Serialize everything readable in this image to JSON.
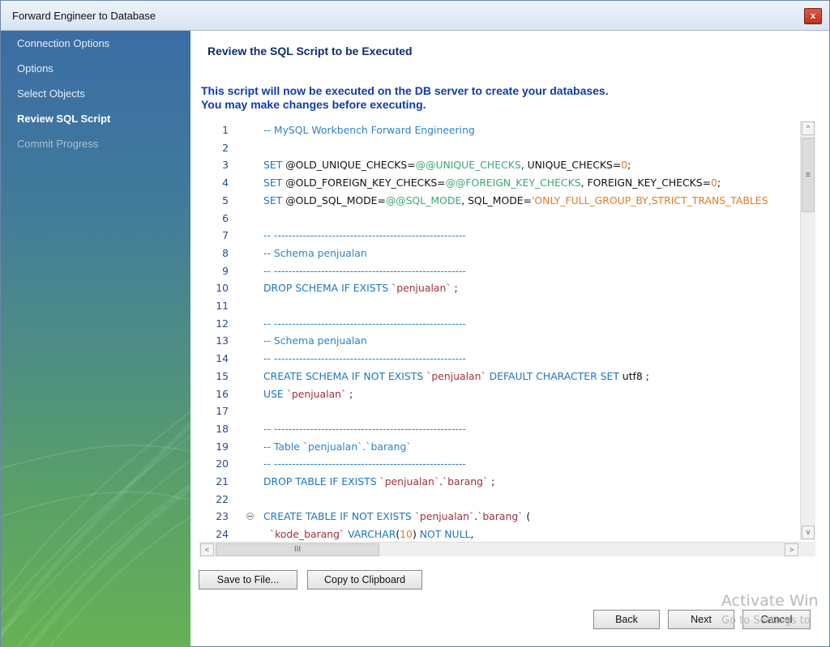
{
  "window": {
    "title": "Forward Engineer to Database",
    "close_glyph": "x"
  },
  "sidebar": {
    "items": [
      {
        "label": "Connection Options",
        "state": "normal"
      },
      {
        "label": "Options",
        "state": "normal"
      },
      {
        "label": "Select Objects",
        "state": "normal"
      },
      {
        "label": "Review SQL Script",
        "state": "active"
      },
      {
        "label": "Commit Progress",
        "state": "disabled"
      }
    ]
  },
  "main": {
    "heading": "Review the SQL Script to be Executed",
    "description_line1": "This script will now be executed on the DB server to create your databases.",
    "description_line2": "You may make changes before executing."
  },
  "editor": {
    "lines": [
      {
        "n": "1",
        "t": [
          [
            "cm",
            "-- MySQL Workbench Forward Engineering"
          ]
        ]
      },
      {
        "n": "2",
        "t": []
      },
      {
        "n": "3",
        "t": [
          [
            "kw",
            "SET "
          ],
          [
            "",
            "@OLD_UNIQUE_CHECKS="
          ],
          [
            "sv",
            "@@UNIQUE_CHECKS"
          ],
          [
            "",
            ", UNIQUE_CHECKS="
          ],
          [
            "num",
            "0"
          ],
          [
            "",
            ";"
          ]
        ]
      },
      {
        "n": "4",
        "t": [
          [
            "kw",
            "SET "
          ],
          [
            "",
            "@OLD_FOREIGN_KEY_CHECKS="
          ],
          [
            "sv",
            "@@FOREIGN_KEY_CHECKS"
          ],
          [
            "",
            ", FOREIGN_KEY_CHECKS="
          ],
          [
            "num",
            "0"
          ],
          [
            "",
            ";"
          ]
        ]
      },
      {
        "n": "5",
        "t": [
          [
            "kw",
            "SET "
          ],
          [
            "",
            "@OLD_SQL_MODE="
          ],
          [
            "sv",
            "@@SQL_MODE"
          ],
          [
            "",
            ", SQL_MODE="
          ],
          [
            "str",
            "'ONLY_FULL_GROUP_BY,STRICT_TRANS_TABLES"
          ]
        ]
      },
      {
        "n": "6",
        "t": []
      },
      {
        "n": "7",
        "t": [
          [
            "cm",
            "-- -----------------------------------------------------"
          ]
        ]
      },
      {
        "n": "8",
        "t": [
          [
            "cm",
            "-- Schema penjualan"
          ]
        ]
      },
      {
        "n": "9",
        "t": [
          [
            "cm",
            "-- -----------------------------------------------------"
          ]
        ]
      },
      {
        "n": "10",
        "t": [
          [
            "kw",
            "DROP SCHEMA IF EXISTS "
          ],
          [
            "bt",
            "`penjualan`"
          ],
          [
            "",
            " ;"
          ]
        ]
      },
      {
        "n": "11",
        "t": []
      },
      {
        "n": "12",
        "t": [
          [
            "cm",
            "-- -----------------------------------------------------"
          ]
        ]
      },
      {
        "n": "13",
        "t": [
          [
            "cm",
            "-- Schema penjualan"
          ]
        ]
      },
      {
        "n": "14",
        "t": [
          [
            "cm",
            "-- -----------------------------------------------------"
          ]
        ]
      },
      {
        "n": "15",
        "t": [
          [
            "kw",
            "CREATE SCHEMA IF NOT EXISTS "
          ],
          [
            "bt",
            "`penjualan`"
          ],
          [
            "kw",
            " DEFAULT CHARACTER SET "
          ],
          [
            "",
            "utf8 ;"
          ]
        ]
      },
      {
        "n": "16",
        "t": [
          [
            "kw",
            "USE "
          ],
          [
            "bt",
            "`penjualan`"
          ],
          [
            "",
            " ;"
          ]
        ]
      },
      {
        "n": "17",
        "t": []
      },
      {
        "n": "18",
        "t": [
          [
            "cm",
            "-- -----------------------------------------------------"
          ]
        ]
      },
      {
        "n": "19",
        "t": [
          [
            "cm",
            "-- Table `penjualan`.`barang`"
          ]
        ]
      },
      {
        "n": "20",
        "t": [
          [
            "cm",
            "-- -----------------------------------------------------"
          ]
        ]
      },
      {
        "n": "21",
        "t": [
          [
            "kw",
            "DROP TABLE IF EXISTS "
          ],
          [
            "bt",
            "`penjualan`"
          ],
          [
            "",
            "."
          ],
          [
            "bt",
            "`barang`"
          ],
          [
            "",
            " ;"
          ]
        ]
      },
      {
        "n": "22",
        "t": []
      },
      {
        "n": "23",
        "t": [
          [
            "kw",
            "CREATE TABLE IF NOT EXISTS "
          ],
          [
            "bt",
            "`penjualan`"
          ],
          [
            "",
            "."
          ],
          [
            "bt",
            "`barang`"
          ],
          [
            "",
            " ("
          ]
        ],
        "fold": true
      },
      {
        "n": "24",
        "t": [
          [
            "",
            "  "
          ],
          [
            "bt",
            "`kode_barang`"
          ],
          [
            "kw",
            " VARCHAR"
          ],
          [
            "",
            "("
          ],
          [
            "num",
            "10"
          ],
          [
            "",
            ") "
          ],
          [
            "kw",
            "NOT NULL"
          ],
          [
            "",
            ","
          ]
        ]
      }
    ]
  },
  "scrollbars": {
    "up_glyph": "^",
    "down_glyph": "v",
    "left_glyph": "<",
    "right_glyph": ">",
    "v_grip": "≡",
    "h_grip": "III"
  },
  "buttons": {
    "save_to_file": "Save to File...",
    "copy_to_clipboard": "Copy to Clipboard",
    "back": "Back",
    "next": "Next",
    "cancel": "Cancel"
  },
  "watermark": {
    "line1": "Activate Win",
    "line2": "Go to Settings to"
  }
}
